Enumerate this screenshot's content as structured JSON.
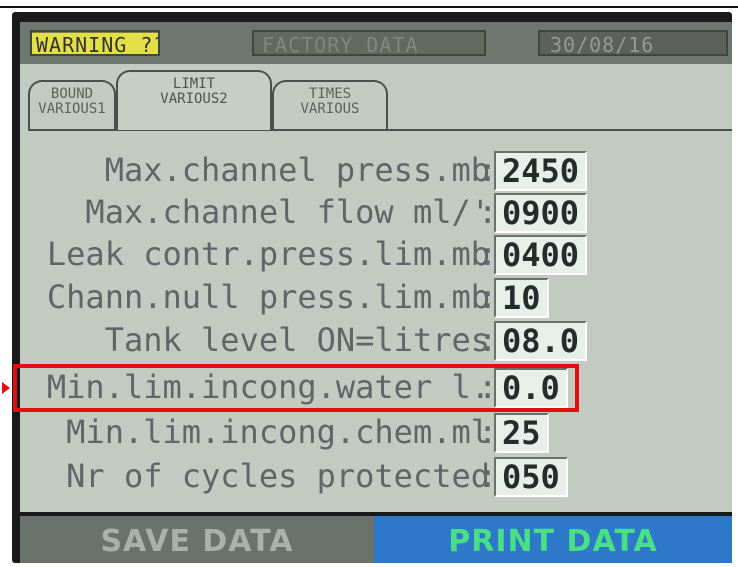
{
  "status_bar": {
    "warning": "WARNING ??",
    "factory": "FACTORY DATA",
    "date": "30/08/16"
  },
  "tabs": [
    {
      "line1": "BOUND",
      "line2": "VARIOUS1"
    },
    {
      "line1": "LIMIT",
      "line2": "VARIOUS2"
    },
    {
      "line1": "TIMES",
      "line2": "VARIOUS"
    }
  ],
  "params": [
    {
      "label": "Max.channel press.mb",
      "value": "2450"
    },
    {
      "label": "Max.channel flow ml/'",
      "value": "0900"
    },
    {
      "label": "Leak contr.press.lim.mb",
      "value": "0400"
    },
    {
      "label": "Chann.null press.lim.mb",
      "value": "10"
    },
    {
      "label": "Tank level ON=litres",
      "value": "08.0"
    },
    {
      "label": "Min.lim.incong.water l.",
      "value": "0.0"
    },
    {
      "label": "Min.lim.incong.chem.ml",
      "value": "25"
    },
    {
      "label": "Nr of cycles protected",
      "value": "050"
    }
  ],
  "buttons": {
    "save": "SAVE DATA",
    "print": "PRINT DATA"
  },
  "colors": {
    "screen_bg": "#c3cac2",
    "highlight": "#e30d13",
    "print_bg": "#2d78c8",
    "print_text": "#49df86"
  }
}
